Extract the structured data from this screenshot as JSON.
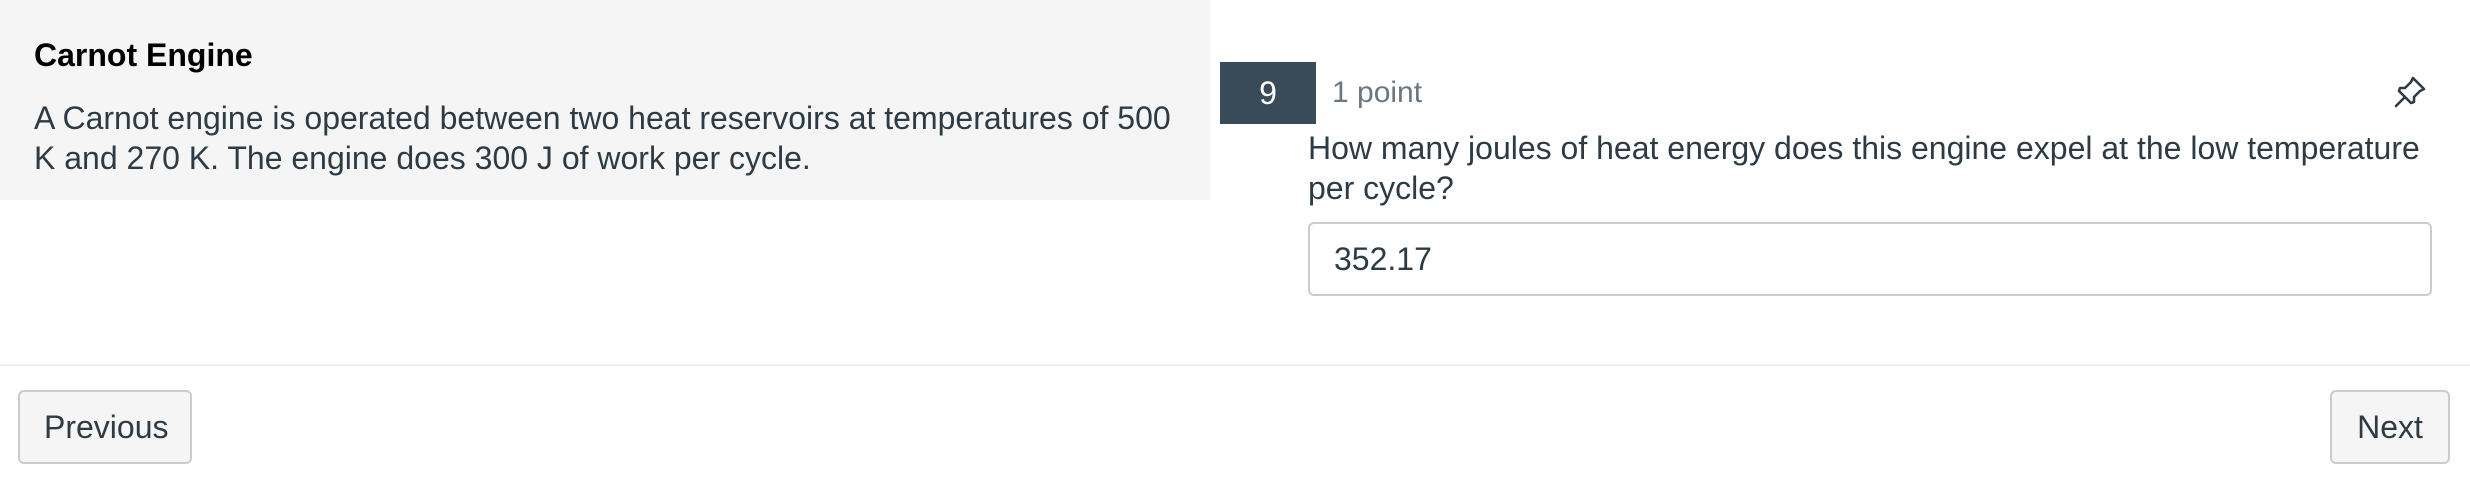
{
  "stimulus": {
    "title": "Carnot Engine",
    "body": "A Carnot engine is operated between two heat reservoirs at temperatures of 500 K and 270 K. The engine does 300 J of work per cycle."
  },
  "question": {
    "number": "9",
    "points": "1 point",
    "text": "How many joules of heat energy does this engine expel at the low temperature per cycle?",
    "answer_value": "352.17",
    "pin_icon": "pin-icon"
  },
  "navigation": {
    "previous_label": "Previous",
    "next_label": "Next"
  },
  "colors": {
    "stimulus_background": "#f5f5f5",
    "question_number_background": "#394b58",
    "text": "#2d3b45",
    "muted_text": "#6b7780",
    "border": "#c7cdd1"
  }
}
